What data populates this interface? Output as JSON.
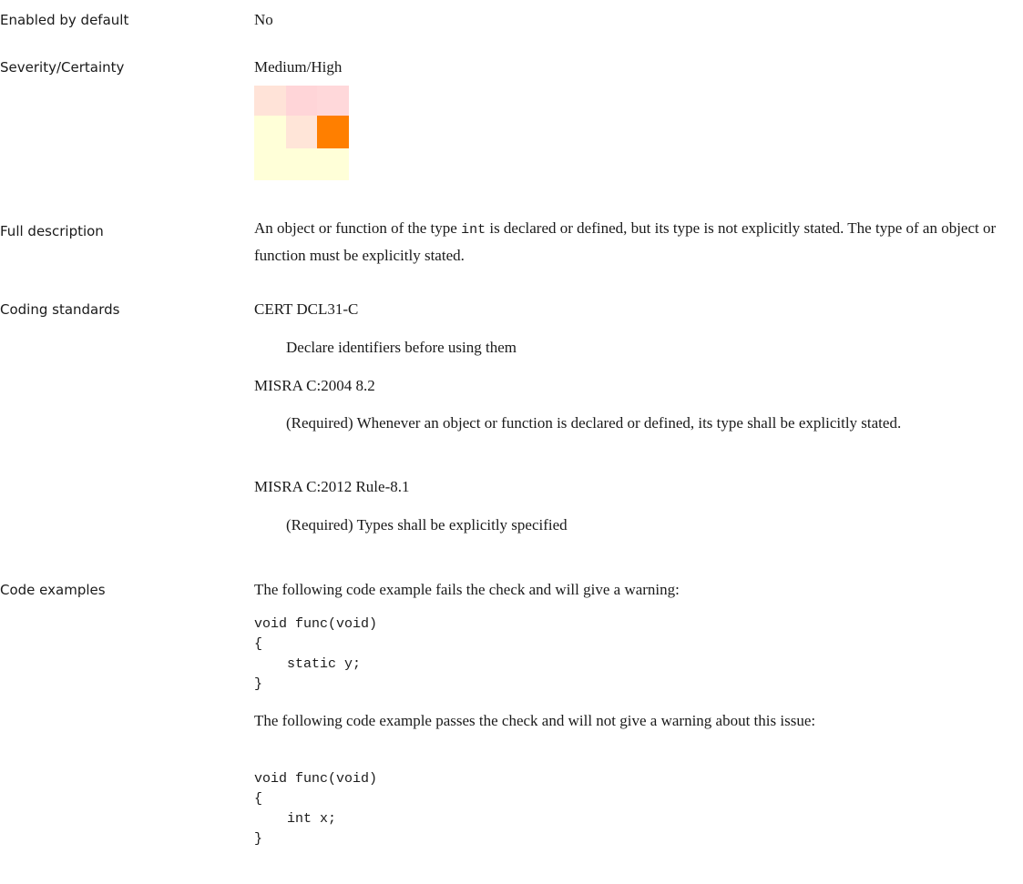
{
  "rows": {
    "enabled": {
      "label": "Enabled by default",
      "value": "No"
    },
    "severity": {
      "label": "Severity/Certainty",
      "value": "Medium/High",
      "matrix_colors": [
        [
          "#ffe3d8",
          "#ffd5d8",
          "#ffd8da"
        ],
        [
          "#ffffd8",
          "#ffe5d8",
          "#ff7f00"
        ],
        [
          "#ffffd8",
          "#ffffd8",
          "#ffffd8"
        ]
      ]
    },
    "description": {
      "label": "Full description",
      "text_before": "An object or function of the type ",
      "inline_code": "int",
      "text_after": " is declared or defined, but its type is not explicitly stated. The type of an object or function must be explicitly stated."
    },
    "standards": {
      "label": "Coding standards",
      "items": [
        {
          "name": "CERT DCL31-C",
          "desc": "Declare identifiers before using them"
        },
        {
          "name": "MISRA C:2004 8.2",
          "desc": "(Required) Whenever an object or function is declared or defined, its type shall be explicitly stated."
        },
        {
          "name": "MISRA C:2012 Rule-8.1",
          "desc": "(Required) Types shall be explicitly specified"
        }
      ]
    },
    "examples": {
      "label": "Code examples",
      "fail_intro": "The following code example fails the check and will give a warning:",
      "fail_code": "void func(void)\n{\n    static y;\n}",
      "pass_intro": "The following code example passes the check and will not give a warning about this issue:",
      "pass_code": "void func(void)\n{\n    int x;\n}"
    }
  }
}
